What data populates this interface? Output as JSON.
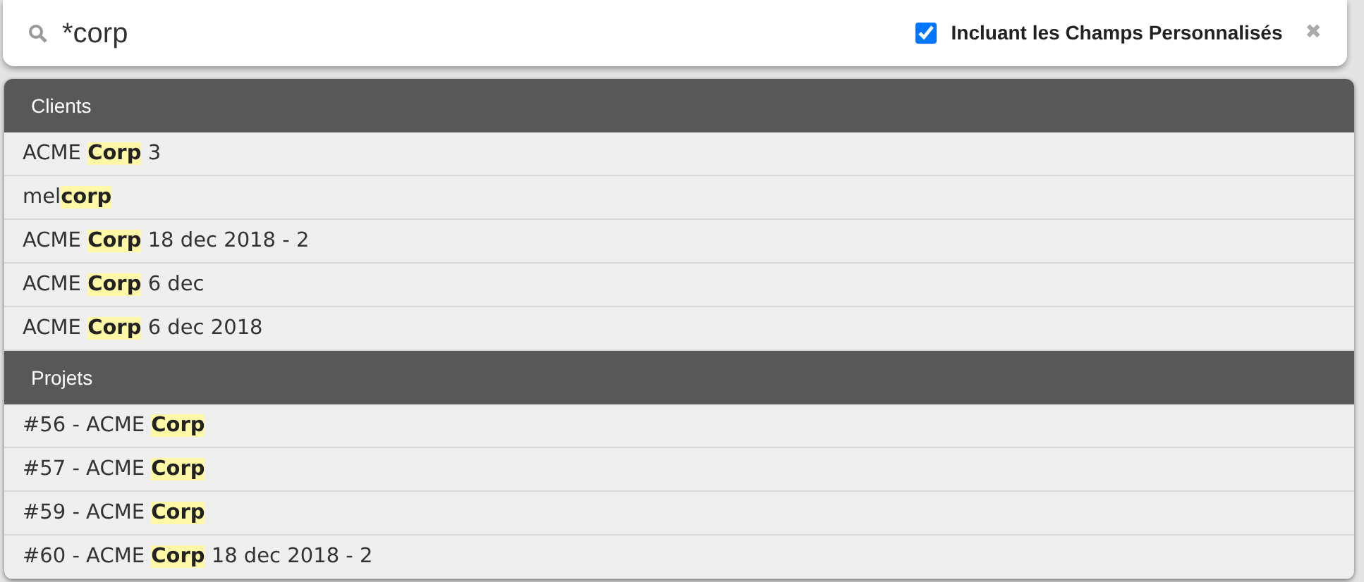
{
  "search": {
    "value": "*corp",
    "include_custom_fields": {
      "label": "Incluant les Champs Personnalisés",
      "checked": true
    },
    "clear": "✖"
  },
  "groups": [
    {
      "title": "Clients",
      "items": [
        "ACME **Corp** 3",
        "mel**corp**",
        "ACME **Corp** 18 dec 2018 - 2",
        "ACME **Corp** 6 dec",
        "ACME **Corp** 6 dec 2018"
      ]
    },
    {
      "title": "Projets",
      "items": [
        "#56 - ACME **Corp**",
        "#57 - ACME **Corp**",
        "#59 - ACME **Corp**",
        "#60 - ACME **Corp** 18 dec 2018 - 2"
      ]
    }
  ]
}
